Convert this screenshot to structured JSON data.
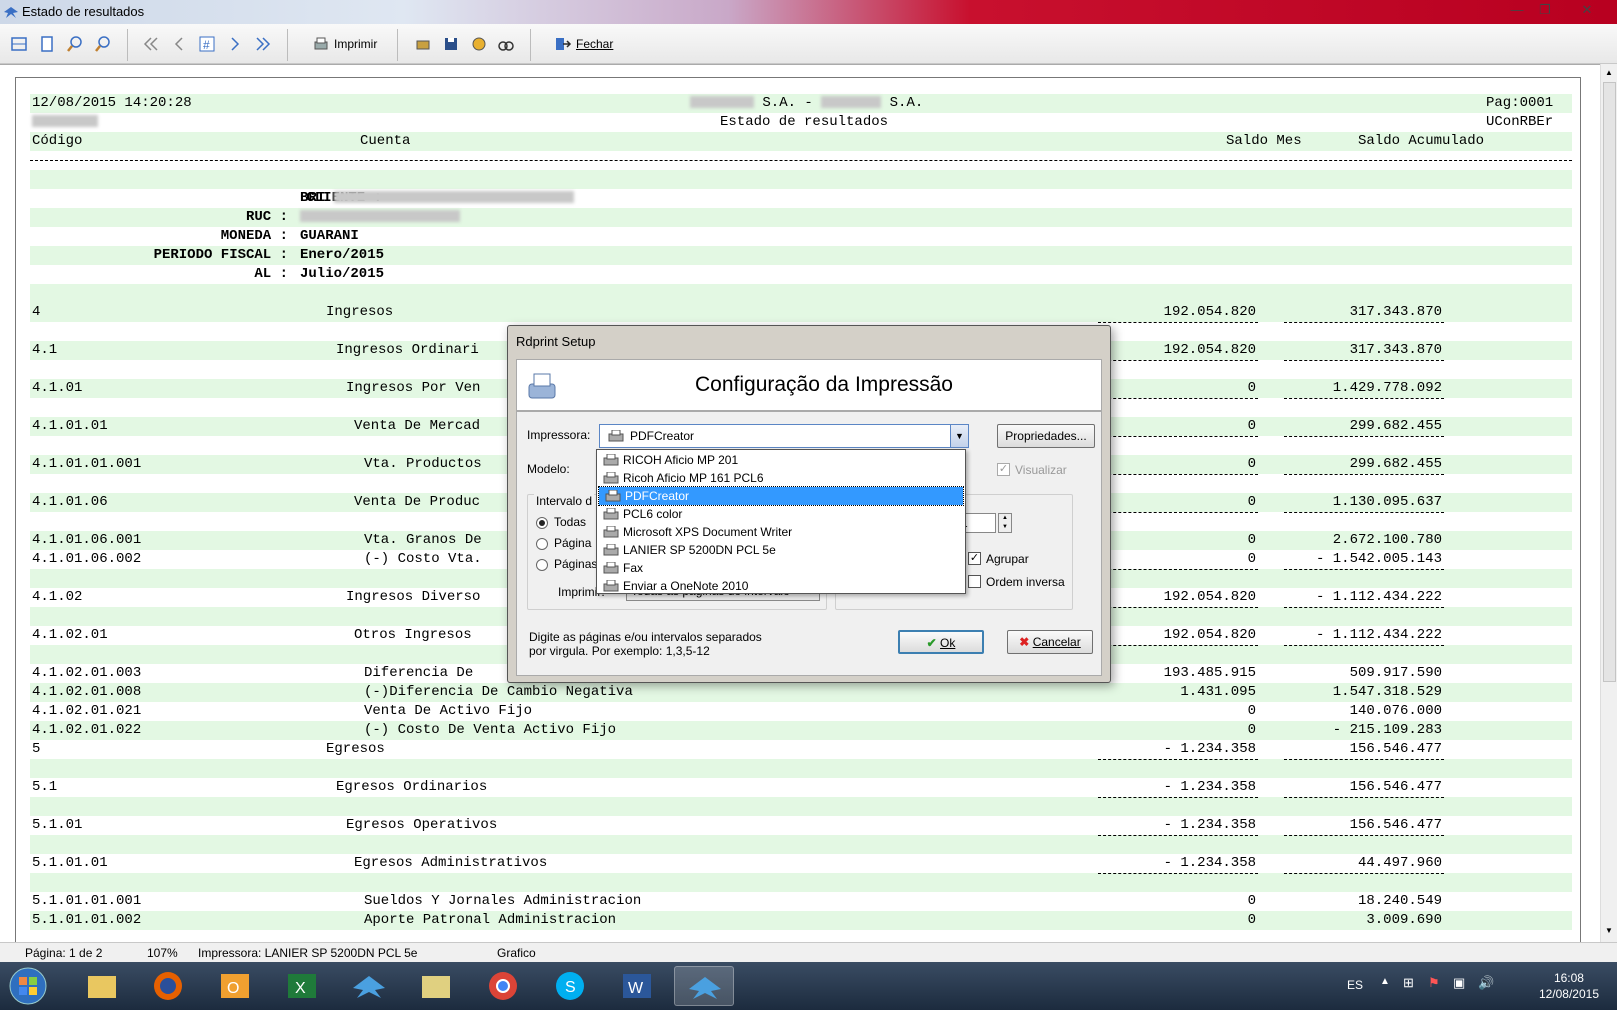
{
  "window": {
    "title": "Estado de resultados"
  },
  "toolbar": {
    "print_label": "Imprimir",
    "close_label": "Fechar"
  },
  "report": {
    "datetime": "12/08/2015 14:20:28",
    "company_part1": "S.A. -",
    "company_part2": "S.A.",
    "page": "Pag:0001",
    "title": "Estado de resultados",
    "code": "UConRBEr",
    "headers": {
      "code": "Código",
      "account": "Cuenta",
      "month": "Saldo Mes",
      "accum": "Saldo Acumulado"
    },
    "client_label": "CLIENTE :",
    "client_value": "BRI",
    "ruc_label": "RUC :",
    "currency_label": "MONEDA :",
    "currency_value": "GUARANI",
    "period_label": "PERIODO FISCAL :",
    "period_value": "Enero/2015",
    "al_label": "AL :",
    "al_value": "Julio/2015",
    "rows": [
      {
        "code": "4",
        "name": "Ingresos",
        "month": "192.054.820",
        "accum": "317.343.870"
      },
      {
        "code": "4.1",
        "name": "Ingresos Ordinari",
        "month": "192.054.820",
        "accum": "317.343.870"
      },
      {
        "code": "4.1.01",
        "name": "Ingresos Por Ven",
        "month": "0",
        "accum": "1.429.778.092"
      },
      {
        "code": "4.1.01.01",
        "name": "Venta De Mercad",
        "month": "0",
        "accum": "299.682.455"
      },
      {
        "code": "4.1.01.01.001",
        "name": "Vta. Productos",
        "month": "0",
        "accum": "299.682.455"
      },
      {
        "code": "4.1.01.06",
        "name": "Venta De Produc",
        "month": "0",
        "accum": "1.130.095.637"
      },
      {
        "code": "4.1.01.06.001",
        "name": "Vta. Granos De",
        "month": "0",
        "accum": "2.672.100.780"
      },
      {
        "code": "4.1.01.06.002",
        "name": "(-) Costo Vta.",
        "month": "0",
        "accum": "- 1.542.005.143"
      },
      {
        "code": "4.1.02",
        "name": "Ingresos Diverso",
        "month": "192.054.820",
        "accum": "- 1.112.434.222"
      },
      {
        "code": "4.1.02.01",
        "name": "Otros Ingresos",
        "month": "192.054.820",
        "accum": "- 1.112.434.222"
      },
      {
        "code": "4.1.02.01.003",
        "name": "Diferencia De",
        "month": "193.485.915",
        "accum": "509.917.590"
      },
      {
        "code": "4.1.02.01.008",
        "name": "(-)Diferencia De Cambio Negativa",
        "month": "1.431.095",
        "accum": "1.547.318.529"
      },
      {
        "code": "4.1.02.01.021",
        "name": "Venta De Activo Fijo",
        "month": "0",
        "accum": "140.076.000"
      },
      {
        "code": "4.1.02.01.022",
        "name": "(-) Costo De Venta Activo Fijo",
        "month": "0",
        "accum": "- 215.109.283"
      },
      {
        "code": "5",
        "name": "Egresos",
        "month": "- 1.234.358",
        "accum": "156.546.477"
      },
      {
        "code": "5.1",
        "name": "Egresos Ordinarios",
        "month": "- 1.234.358",
        "accum": "156.546.477"
      },
      {
        "code": "5.1.01",
        "name": "Egresos Operativos",
        "month": "- 1.234.358",
        "accum": "156.546.477"
      },
      {
        "code": "5.1.01.01",
        "name": "Egresos Administrativos",
        "month": "- 1.234.358",
        "accum": "44.497.960"
      },
      {
        "code": "5.1.01.01.001",
        "name": "Sueldos Y Jornales Administracion",
        "month": "0",
        "accum": "18.240.549"
      },
      {
        "code": "5.1.01.01.002",
        "name": "Aporte Patronal Administracion",
        "month": "0",
        "accum": "3.009.690"
      }
    ]
  },
  "dialog": {
    "title": "Rdprint Setup",
    "heading": "Configuração da Impressão",
    "printer_label": "Impressora:",
    "printer_value": "PDFCreator",
    "properties_button": "Propriedades...",
    "model_label": "Modelo:",
    "preview_label": "Visualizar",
    "interval_label": "Intervalo d",
    "radio_all": "Todas",
    "radio_page": "Página",
    "radio_pages": "Páginas",
    "print_label": "Imprimir:",
    "print_value": "Todas as páginas do intervalo",
    "copies_value": "1",
    "group_label": "Agrupar",
    "reverse_label": "Ordem inversa",
    "hint_line1": "Digite as páginas e/ou intervalos separados",
    "hint_line2": "por virgula.  Por exemplo: 1,3,5-12",
    "ok_button": "Ok",
    "cancel_button": "Cancelar",
    "printer_options": [
      "RICOH Aficio MP 201",
      "Ricoh Aficio MP 161 PCL6",
      "PDFCreator",
      "PCL6 color",
      "Microsoft XPS Document Writer",
      "LANIER SP 5200DN PCL 5e",
      "Fax",
      "Enviar a OneNote 2010"
    ]
  },
  "status": {
    "page": "Página: 1 de 2",
    "zoom": "107%",
    "printer": "Impressora: LANIER SP 5200DN PCL 5e",
    "mode": "Grafico"
  },
  "taskbar": {
    "lang": "ES",
    "time": "16:08",
    "date": "12/08/2015"
  }
}
